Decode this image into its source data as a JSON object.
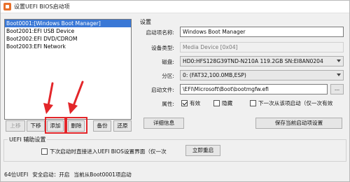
{
  "window": {
    "title": "设置UEFI BIOS启动项"
  },
  "boot_list": {
    "items": [
      {
        "label": "Boot0001:[Windows Boot Manager]",
        "selected": true
      },
      {
        "label": "Boot2001:EFI USB Device",
        "selected": false
      },
      {
        "label": "Boot2002:EFI DVD/CDROM",
        "selected": false
      },
      {
        "label": "Boot2003:EFI Network",
        "selected": false
      }
    ]
  },
  "buttons": {
    "move_up": "上移",
    "move_down": "下移",
    "add": "添加",
    "delete": "删除",
    "backup": "备份",
    "restore": "还原",
    "details": "详细信息",
    "save_current": "保存当前启动项设置",
    "restart_now": "立即重启",
    "browse": "..."
  },
  "settings": {
    "title": "设置",
    "name_label": "启动项名称:",
    "name_value": "Windows Boot Manager",
    "device_type_label": "设备类型:",
    "device_type_value": "Media Device [0x04]",
    "disk_label": "磁盘:",
    "disk_value": "HD0:HFS128G39TND-N210A 119.2GB SN:EI8AN0204",
    "partition_label": "分区:",
    "partition_value": "0: (FAT32,100.0MB,ESP)",
    "file_label": "启动文件:",
    "file_value": "\\EFI\\Microsoft\\Boot\\bootmgfw.efi",
    "attr_label": "属性:",
    "attr_options": [
      {
        "label": "有效",
        "checked": true
      },
      {
        "label": "隐藏",
        "checked": false
      },
      {
        "label": "下一次从该项启动（仅一次有效",
        "checked": false
      }
    ]
  },
  "uefi_aux": {
    "title": "UEFI 辅助设置",
    "checkbox_label": "下次启动时直接进入UEFI BIOS设置界面（仅一次",
    "checked": false
  },
  "status": {
    "bitness": "64位UEFI",
    "secure_boot": "安全启动：开启",
    "current_boot": "当前从Boot0001项启动"
  },
  "colors": {
    "selection": "#3a78d6",
    "highlight": "#e3262a",
    "app_icon": "#e8702a"
  }
}
